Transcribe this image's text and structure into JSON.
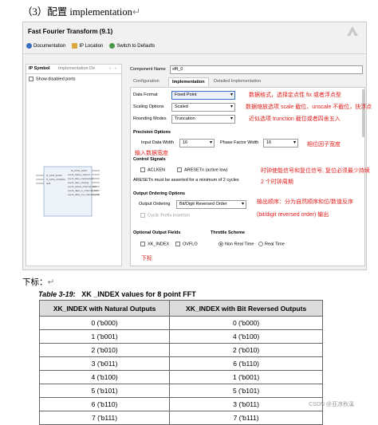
{
  "heading": "（3）配置 implementation",
  "dialog": {
    "title": "Fast Fourier Transform (9.1)",
    "toolbar": {
      "documentation": "Documentation",
      "ip_location": "IP Location",
      "switch_defaults": "Switch to Defaults"
    },
    "left_tabs": [
      "IP Symbol",
      "Implementation De"
    ],
    "show_disabled_ports": "Show disabled ports",
    "component_name_label": "Component Name",
    "component_name_value": "xfft_0",
    "tabs": [
      "Configuration",
      "Implementation",
      "Detailed Implementation"
    ],
    "fields": {
      "data_format_label": "Data Format",
      "data_format_value": "Fixed Point",
      "scaling_label": "Scaling Options",
      "scaling_value": "Scaled",
      "rounding_label": "Rounding Modes",
      "rounding_value": "Truncation"
    },
    "precision": {
      "title": "Precision Options",
      "input_label": "Input Data Width",
      "input_value": "16",
      "phase_label": "Phase Factor Width",
      "phase_value": "16"
    },
    "control": {
      "title": "Control Signals",
      "aclken": "ACLKEN",
      "aresetn": "ARESETn (active low)",
      "note": "ARESETn must be asserted for a minimum of 2 cycles"
    },
    "ordering": {
      "title": "Output Ordering Options",
      "label": "Output Ordering",
      "value": "Bit/Digit Reversed Order",
      "cyclic": "Cyclic Prefix Insertion"
    },
    "optional": {
      "title": "Optional Output Fields",
      "xk_index": "XK_INDEX",
      "ovflo": "OVFLO"
    },
    "throttle": {
      "title": "Throttle Scheme",
      "non_real": "Non Real Time",
      "real": "Real Time"
    }
  },
  "annotations": {
    "a1": "数据格式，选择定点性 fix 或者浮点型",
    "a2": "数据缩放选项 scale 截位、unscale 不截位，抉浮点",
    "a3": "近似选项 trunction 截位或者四舍五入",
    "a4": "相位因子宽度",
    "a5": "输入数据宽度",
    "a6": "时钟使能信号和复位信号, 复位必须最少持续",
    "a7": "2 个时钟周期",
    "a8": "输出顺序：分为自然顺序和位/数值反序",
    "a9": "(bit/digit reversed order) 输出",
    "a10": "下标"
  },
  "subhead": "下标：",
  "caption": {
    "prefix": "Table 3-19:",
    "text": "XK _INDEX values for 8 point FFT"
  },
  "table": {
    "headers": [
      "XK_INDEX with Natural Outputs",
      "XK_INDEX with Bit Reversed Outputs"
    ],
    "rows": [
      [
        "0 ('b000)",
        "0 ('b000)"
      ],
      [
        "1 ('b001)",
        "4 ('b100)"
      ],
      [
        "2 ('b010)",
        "2 ('b010)"
      ],
      [
        "3 ('b011)",
        "6 ('b110)"
      ],
      [
        "4 ('b100)",
        "1 ('b001)"
      ],
      [
        "5 ('b101)",
        "5 ('b101)"
      ],
      [
        "6 ('b110)",
        "3 ('b011)"
      ],
      [
        "7 ('b111)",
        "7 ('b111)"
      ]
    ]
  },
  "watermark": "CSDN @亚凉秋溪"
}
